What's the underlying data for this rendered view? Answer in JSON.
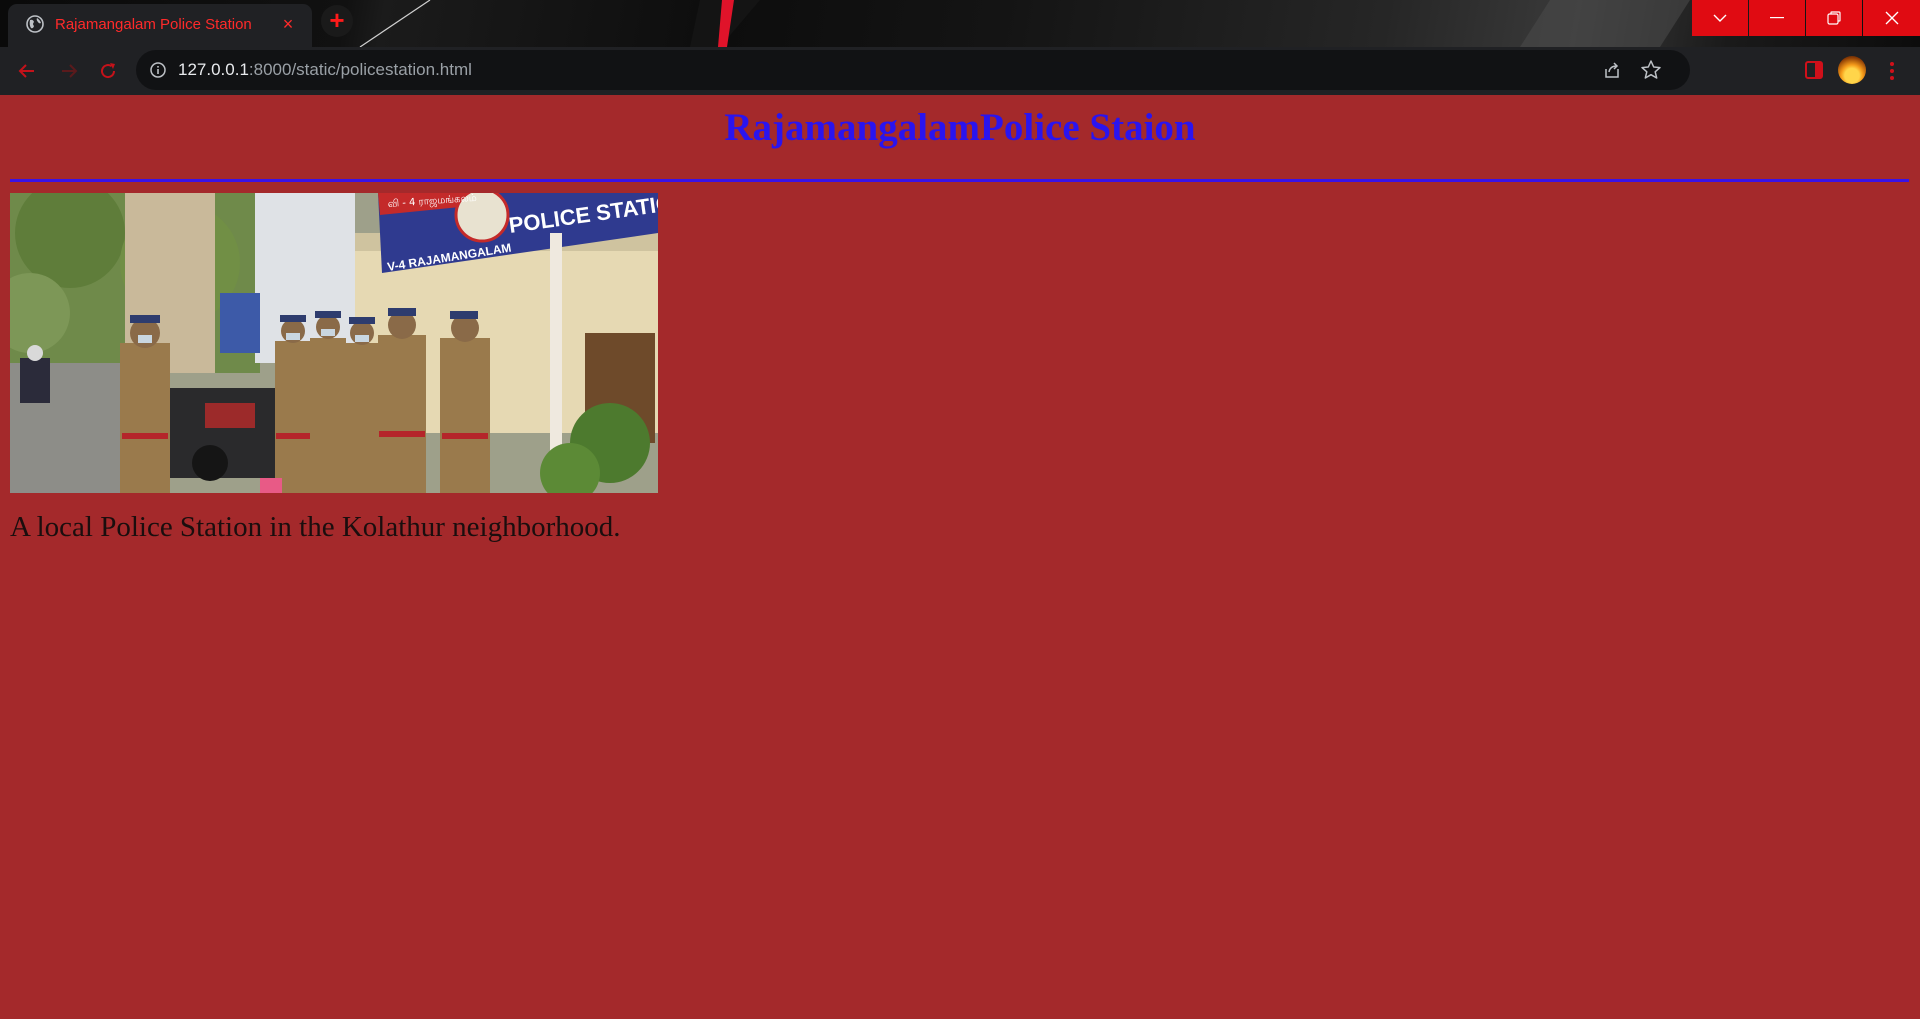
{
  "browser": {
    "tab": {
      "title": "Rajamangalam Police Station",
      "close_glyph": "×",
      "icon": "globe-icon"
    },
    "new_tab_glyph": "+",
    "address": {
      "host": "127.0.0.1",
      "rest": ":8000/static/policestation.html"
    },
    "colors": {
      "accent": "#e00b12",
      "tab_text": "#ff2a2a",
      "frame": "#202124"
    }
  },
  "page": {
    "title": "RajamangalamPolice Staion",
    "image_signage": {
      "tamil_label": "வி - 4 ராஜமங்கலம்",
      "banner": "POLICE STATION",
      "sub_banner": "V-4 RAJAMANGALAM"
    },
    "caption": "A local Police Station in the Kolathur neighborhood.",
    "colors": {
      "background": "#a4292b",
      "title": "#2a14ef",
      "rule": "#3a12e6",
      "caption": "#1a0e0e"
    }
  }
}
